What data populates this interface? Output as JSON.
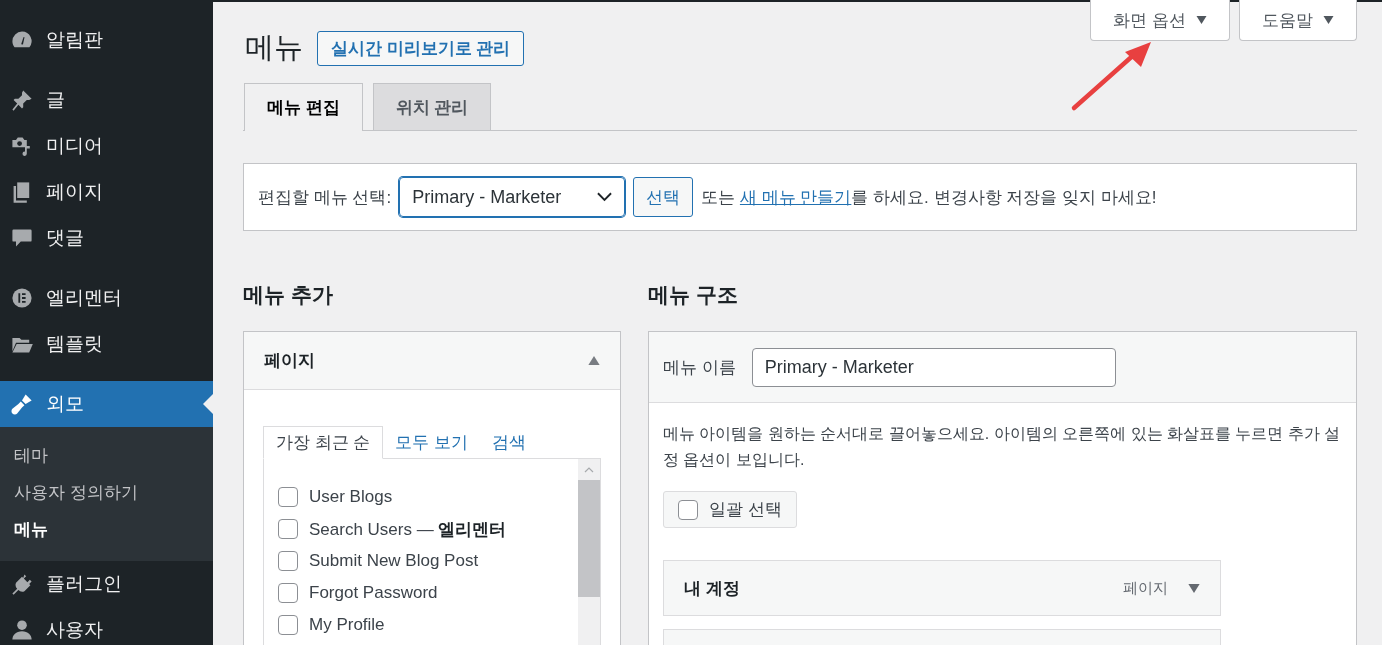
{
  "sidebar": {
    "groups": [
      [
        {
          "label": "알림판",
          "selected": false
        }
      ],
      [
        {
          "label": "글",
          "selected": false
        },
        {
          "label": "미디어",
          "selected": false
        },
        {
          "label": "페이지",
          "selected": false
        },
        {
          "label": "댓글",
          "selected": false
        }
      ],
      [
        {
          "label": "엘리멘터",
          "selected": false
        },
        {
          "label": "템플릿",
          "selected": false
        }
      ],
      [
        {
          "label": "외모",
          "selected": true,
          "children": [
            {
              "label": "테마",
              "selected": false
            },
            {
              "label": "사용자 정의하기",
              "selected": false
            },
            {
              "label": "메뉴",
              "selected": true
            }
          ]
        },
        {
          "label": "플러그인",
          "selected": false
        },
        {
          "label": "사용자",
          "selected": false
        }
      ]
    ]
  },
  "screen_meta": [
    "화면 옵션",
    "도움말"
  ],
  "page_title": "메뉴",
  "title_action": "실시간 미리보기로 관리",
  "tabs": [
    {
      "label": "메뉴 편집",
      "selected": true
    },
    {
      "label": "위치 관리",
      "selected": false
    }
  ],
  "menu_select": {
    "label": "편집할 메뉴 선택:",
    "value": "Primary - Marketer",
    "button": "선택",
    "note": {
      "before": "또는",
      "link": "새 메뉴 만들기",
      "after": "를 하세요. 변경사항 저장을 잊지 마세요!"
    }
  },
  "add_menu_items": {
    "heading": "메뉴 추가",
    "panel": {
      "title": "페이지",
      "expanded": true,
      "tabs": [
        {
          "label": "가장 최근 순",
          "selected": true
        },
        {
          "label": "모두 보기",
          "selected": false
        },
        {
          "label": "검색",
          "selected": false
        }
      ],
      "items": [
        {
          "label": "User Blogs",
          "checked": false
        },
        {
          "label": "Search Users — **엘리멘터**",
          "checked": false
        },
        {
          "label": "Submit New Blog Post",
          "checked": false
        },
        {
          "label": "Forgot Password",
          "checked": false
        },
        {
          "label": "My Profile",
          "checked": false
        }
      ]
    }
  },
  "menu_structure": {
    "heading": "메뉴 구조",
    "name_label": "메뉴 이름",
    "name_value": "Primary - Marketer",
    "instructions": "메뉴 아이템을 원하는 순서대로 끌어놓으세요. 아이템의 오른쪽에 있는 화살표를 누르면 추가 설정 옵션이 보입니다.",
    "bulk_select": {
      "label": "일괄 선택",
      "checked": false
    },
    "items": [
      {
        "title": "내 계정",
        "type": "페이지"
      }
    ]
  }
}
